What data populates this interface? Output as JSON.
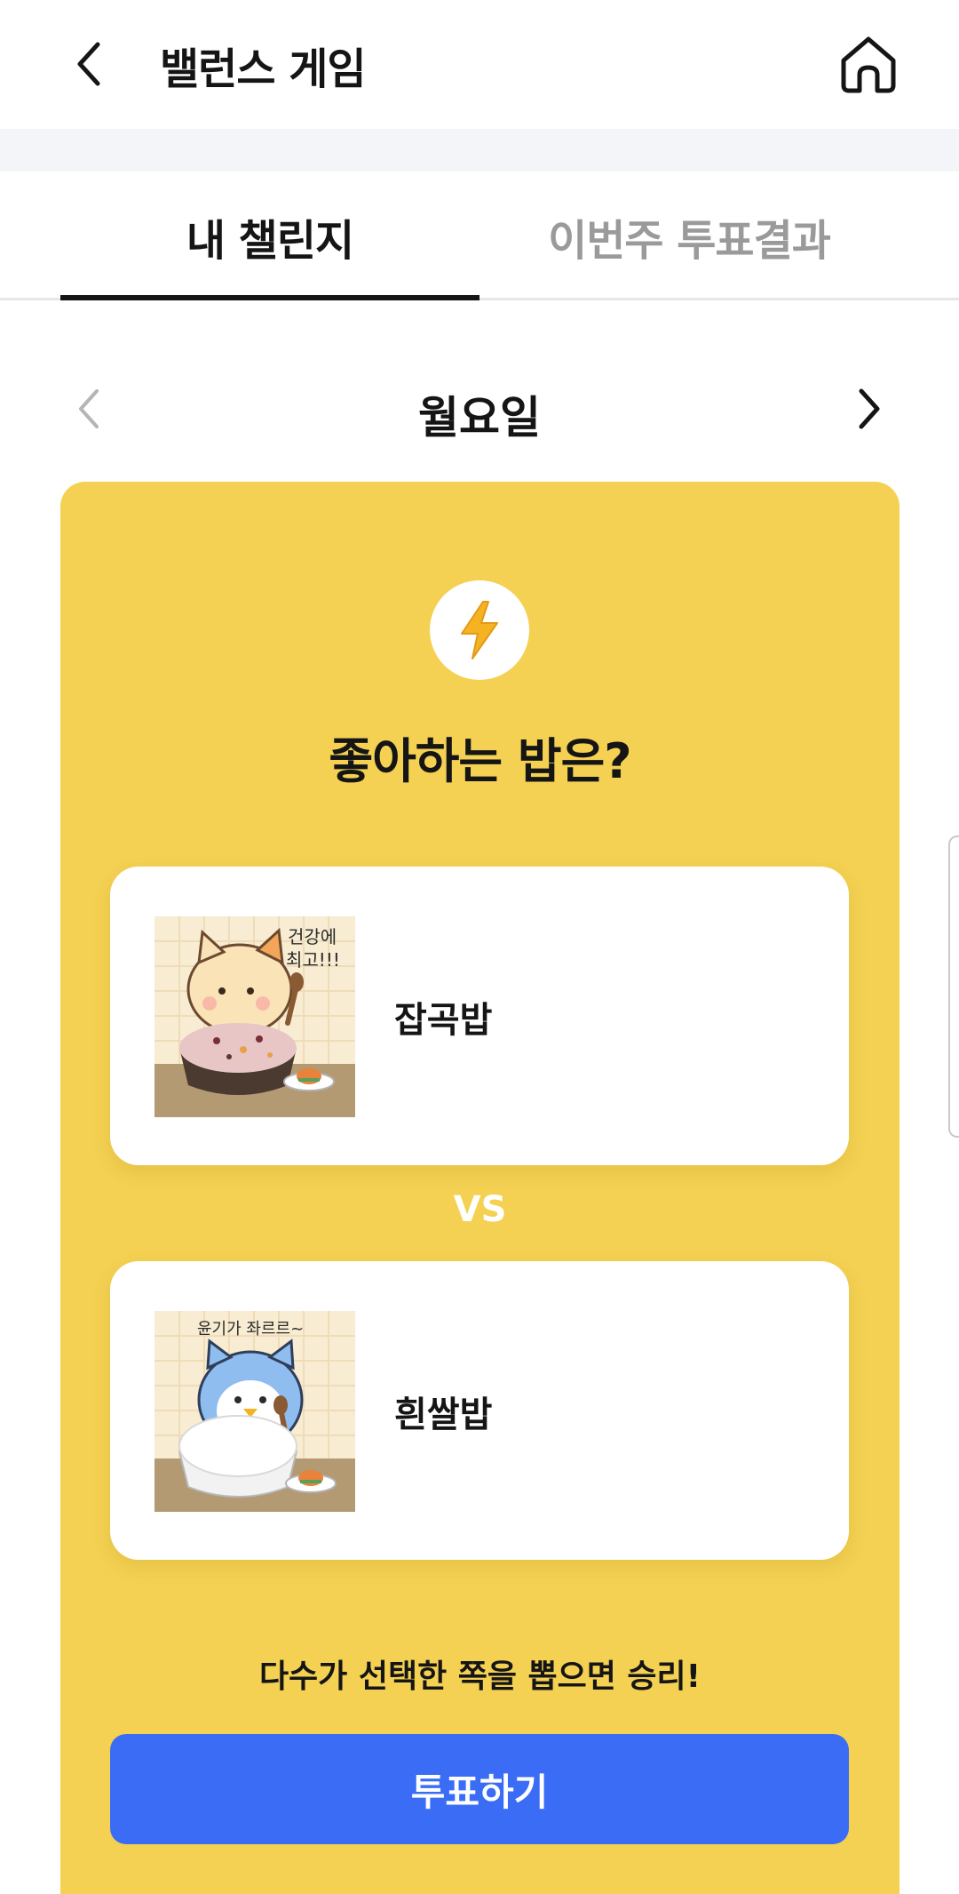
{
  "header": {
    "title": "밸런스 게임",
    "back_icon": "chevron-left-icon",
    "home_icon": "home-icon"
  },
  "tabs": [
    {
      "label": "내 챌린지",
      "active": true
    },
    {
      "label": "이번주 투표결과",
      "active": false
    }
  ],
  "day_nav": {
    "day": "월요일",
    "prev_icon": "chevron-left-icon",
    "next_icon": "chevron-right-icon"
  },
  "challenge": {
    "icon": "lightning-bolt-icon",
    "question": "좋아하는 밥은?",
    "options": [
      {
        "label": "잡곡밥",
        "illustration_text": [
          "건강에",
          "최고!!!"
        ]
      },
      {
        "label": "흰쌀밥",
        "illustration_text": [
          "윤기가 좌르르~"
        ]
      }
    ],
    "vs_label": "VS",
    "hint": "다수가 선택한 쪽을 뽑으면 승리!",
    "vote_button": "투표하기"
  },
  "colors": {
    "card_bg": "#f4d152",
    "button_bg": "#3a6cf6",
    "active_tab": "#151515",
    "inactive_tab": "#9a9a9a"
  }
}
